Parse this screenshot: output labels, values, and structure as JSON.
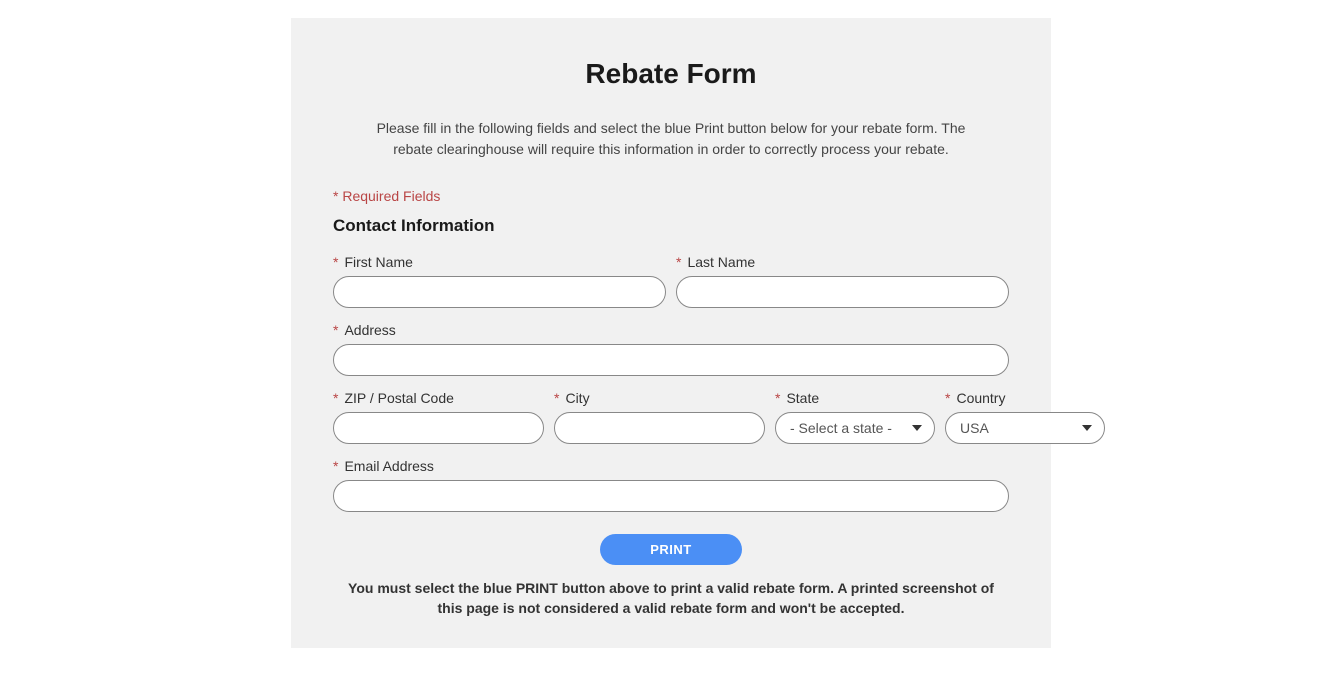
{
  "heading": "Rebate Form",
  "instructions": "Please fill in the following fields and select the blue Print button below for your rebate form. The rebate clearinghouse will require this information in order to correctly process your rebate.",
  "requiredNote": "* Required Fields",
  "sectionHeader": "Contact Information",
  "labels": {
    "firstName": "First Name",
    "lastName": "Last Name",
    "address": "Address",
    "zip": "ZIP / Postal Code",
    "city": "City",
    "state": "State",
    "country": "Country",
    "email": "Email Address"
  },
  "values": {
    "firstName": "",
    "lastName": "",
    "address": "",
    "zip": "",
    "city": "",
    "state": "- Select a state -",
    "country": "USA",
    "email": ""
  },
  "buttons": {
    "print": "PRINT"
  },
  "footerNote": "You must select the blue PRINT button above to print a valid rebate form. A printed screenshot of this page is not considered a valid rebate form and won't be accepted."
}
